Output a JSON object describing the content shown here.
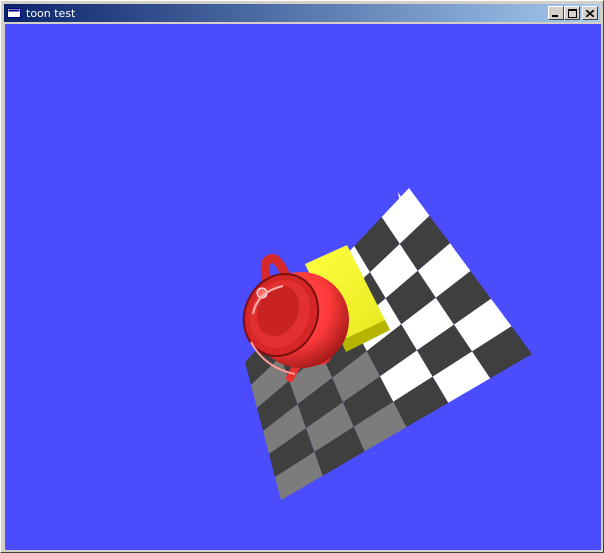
{
  "window": {
    "title": "toon test",
    "icon": "application-window-icon",
    "controls": [
      "minimize-icon",
      "maximize-icon",
      "close-icon"
    ]
  },
  "scene": {
    "background_color": "#4c4cff",
    "floor": {
      "dark_color": "#3f3f3f",
      "light_color": "#ffffff",
      "mid_color": "#7c7c7c"
    },
    "teapot": {
      "color": "#ff3a3a",
      "shadow_color": "#9a1414"
    },
    "box": {
      "color": "#ffff33",
      "side_color": "#a8a800"
    }
  }
}
